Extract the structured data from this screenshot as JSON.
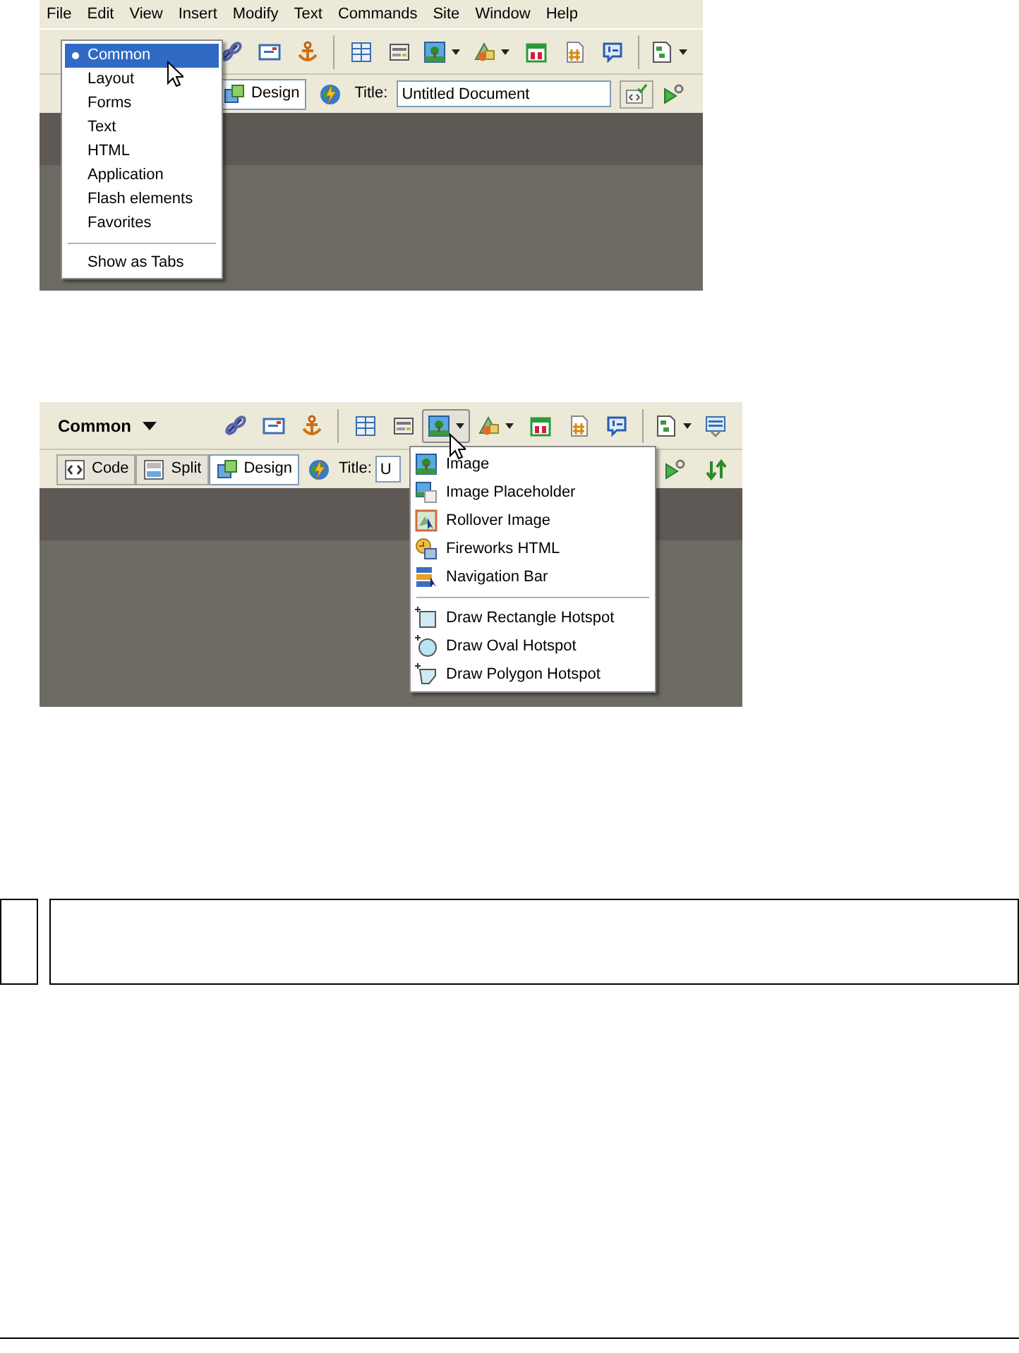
{
  "figure_1": {
    "menu_bar": [
      "File",
      "Edit",
      "View",
      "Insert",
      "Modify",
      "Text",
      "Commands",
      "Site",
      "Window",
      "Help"
    ],
    "category_menu": {
      "items": [
        {
          "label": "Common",
          "selected": true
        },
        {
          "label": "Layout",
          "selected": false
        },
        {
          "label": "Forms",
          "selected": false
        },
        {
          "label": "Text",
          "selected": false
        },
        {
          "label": "HTML",
          "selected": false
        },
        {
          "label": "Application",
          "selected": false
        },
        {
          "label": "Flash elements",
          "selected": false
        },
        {
          "label": "Favorites",
          "selected": false
        }
      ],
      "footer_item": "Show as Tabs"
    },
    "document_toolbar": {
      "view_buttons": [
        {
          "label": "Design",
          "selected": true
        }
      ],
      "title_label": "Title:",
      "title_value": "Untitled Document"
    }
  },
  "figure_2": {
    "category_button": "Common",
    "image_button_open": true,
    "document_toolbar": {
      "view_buttons": [
        {
          "label": "Code",
          "selected": false
        },
        {
          "label": "Split",
          "selected": false
        },
        {
          "label": "Design",
          "selected": true
        }
      ],
      "title_label": "Title:",
      "title_value": "U"
    },
    "image_menu": {
      "items": [
        "Image",
        "Image Placeholder",
        "Rollover Image",
        "Fireworks HTML",
        "Navigation Bar"
      ],
      "hotspot_items": [
        "Draw Rectangle Hotspot",
        "Draw Oval Hotspot",
        "Draw Polygon Hotspot"
      ]
    }
  }
}
